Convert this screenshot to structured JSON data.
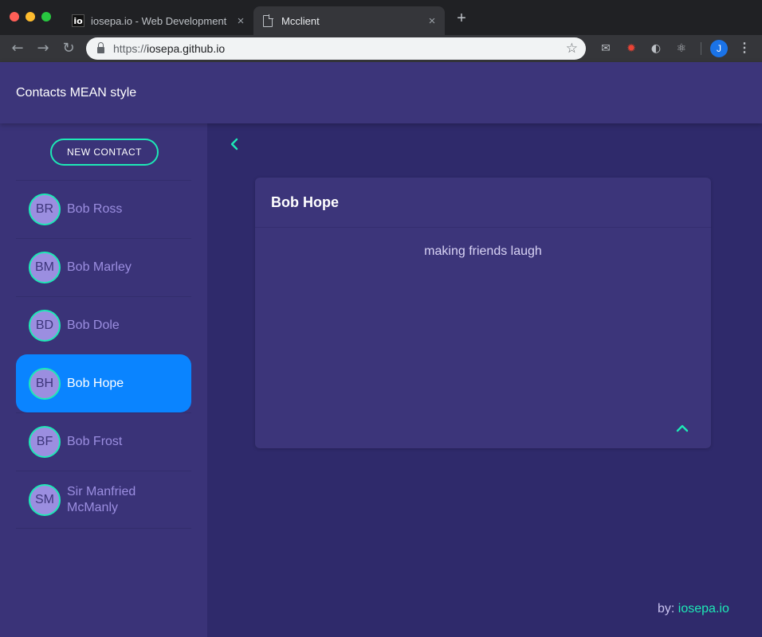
{
  "browser": {
    "tabs": [
      {
        "favicon": "io",
        "title": "iosepa.io - Web Development"
      },
      {
        "title": "Mcclient"
      }
    ],
    "tab_close": "×",
    "new_tab": "+",
    "url_scheme": "https://",
    "url_host": "iosepa.github.io",
    "profile_initial": "J"
  },
  "app": {
    "title": "Contacts MEAN style",
    "new_contact_label": "NEW CONTACT",
    "contacts": [
      {
        "initials": "BR",
        "name": "Bob Ross",
        "selected": false
      },
      {
        "initials": "BM",
        "name": "Bob Marley",
        "selected": false
      },
      {
        "initials": "BD",
        "name": "Bob Dole",
        "selected": false
      },
      {
        "initials": "BH",
        "name": "Bob Hope",
        "selected": true
      },
      {
        "initials": "BF",
        "name": "Bob Frost",
        "selected": false
      },
      {
        "initials": "SM",
        "name": "Sir Manfried McManly",
        "selected": false
      }
    ],
    "detail": {
      "name": "Bob Hope",
      "description": "making friends laugh"
    },
    "footer": {
      "prefix": "by:",
      "link": "iosepa.io"
    }
  },
  "colors": {
    "accent": "#1de9b6",
    "selected": "#0a84ff",
    "header_bg": "#3c357a",
    "sidebar_bg": "#3a3378",
    "content_bg": "#2f2a6b",
    "avatar_bg": "#9b8ee0"
  },
  "icons": [
    "chevron-left-icon",
    "chevron-up-icon",
    "star-icon",
    "lock-icon",
    "back-icon",
    "forward-icon",
    "reload-icon",
    "menu-dots-icon"
  ]
}
